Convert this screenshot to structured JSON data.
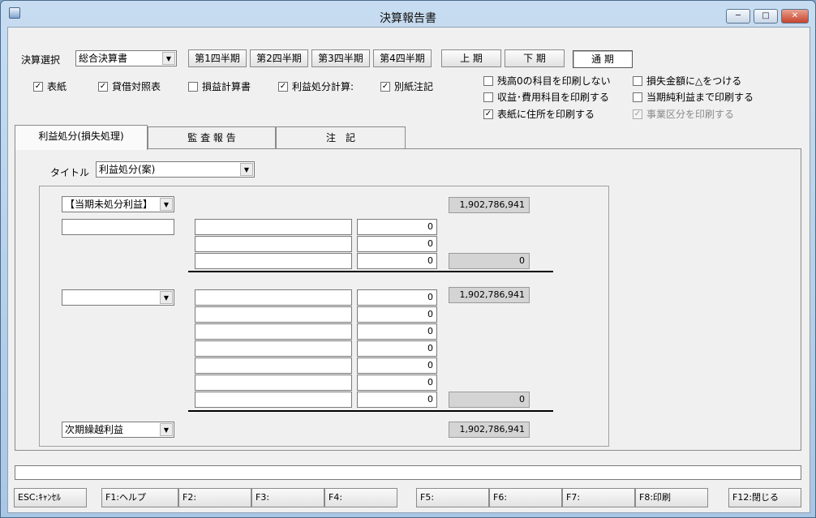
{
  "window": {
    "title": "決算報告書"
  },
  "top": {
    "select_label": "決算選択",
    "select_value": "総合決算書",
    "quarters": [
      "第1四半期",
      "第2四半期",
      "第3四半期",
      "第4四半期"
    ],
    "periods": [
      "上 期",
      "下 期",
      "通 期"
    ]
  },
  "docs": [
    "表紙",
    "貸借対照表",
    "損益計算書",
    "利益処分計算:",
    "別紙注記"
  ],
  "options": [
    "残高0の科目を印刷しない",
    "損失金額に△をつける",
    "収益･費用科目を印刷する",
    "当期純利益まで印刷する",
    "表紙に住所を印刷する",
    "事業区分を印刷する"
  ],
  "tabs": [
    "利益処分(損失処理)",
    "監 査 報 告",
    "注　記"
  ],
  "title_field": {
    "label": "タイトル",
    "value": "利益処分(案)"
  },
  "section1": {
    "combo": "【当期未処分利益】",
    "total": "1,902,786,941",
    "amounts": [
      "0",
      "0",
      "0"
    ],
    "subtotal": "0"
  },
  "section2": {
    "combo": "",
    "total": "1,902,786,941",
    "amounts": [
      "0",
      "0",
      "0",
      "0",
      "0",
      "0",
      "0"
    ],
    "subtotal": "0"
  },
  "footer_row": {
    "combo": "次期繰越利益",
    "total": "1,902,786,941"
  },
  "fkeys": [
    "ESC:ｷｬﾝｾﾙ",
    "F1:ヘルプ",
    "F2:",
    "F3:",
    "F4:",
    "F5:",
    "F6:",
    "F7:",
    "F8:印刷",
    "F12:閉じる"
  ]
}
